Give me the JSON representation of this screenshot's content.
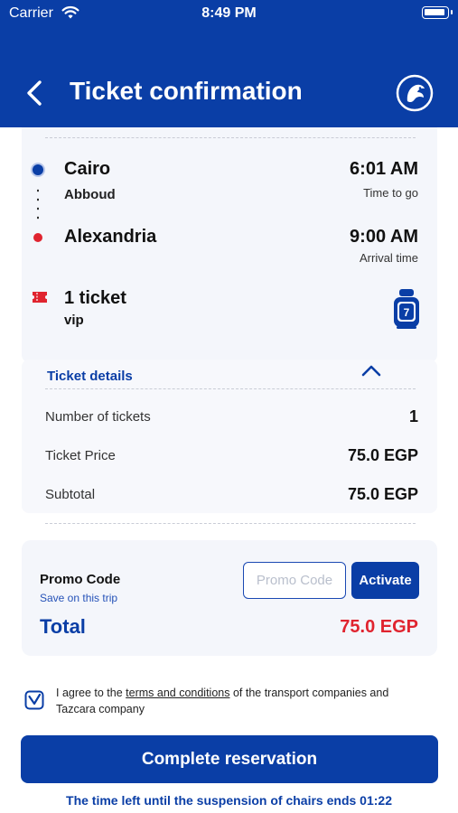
{
  "status_bar": {
    "carrier": "Carrier",
    "time": "8:49 PM"
  },
  "header": {
    "title": "Ticket confirmation",
    "back_icon": "chevron-left-icon",
    "logo_icon": "brand-logo-icon"
  },
  "trip": {
    "origin": {
      "city": "Cairo",
      "station": "Abboud",
      "time": "6:01 AM",
      "time_label": "Time to go"
    },
    "destination": {
      "city": "Alexandria",
      "time": "9:00 AM",
      "time_label": "Arrival time"
    },
    "tickets": "1 ticket",
    "class": "vip",
    "seat_number": "7"
  },
  "details": {
    "toggle_label": "Ticket details",
    "rows": [
      {
        "label": "Number of tickets",
        "value": "1"
      },
      {
        "label": "Ticket Price",
        "value": "75.0 EGP"
      },
      {
        "label": "Subtotal",
        "value": "75.0 EGP"
      }
    ]
  },
  "promo": {
    "title": "Promo Code",
    "subtitle": "Save on this trip",
    "placeholder": "Promo Code",
    "button_label": "Activate"
  },
  "total": {
    "label": "Total",
    "value": "75.0 EGP"
  },
  "agreement": {
    "prefix": "I agree to the ",
    "link": "terms and conditions",
    "suffix": " of the transport companies and Tazcara company"
  },
  "complete_button": "Complete reservation",
  "countdown": "The time left until the suspension of chairs ends 01:22",
  "colors": {
    "primary": "#0a3ea6",
    "accent_red": "#e0242f",
    "card_bg": "#f4f6fb"
  }
}
